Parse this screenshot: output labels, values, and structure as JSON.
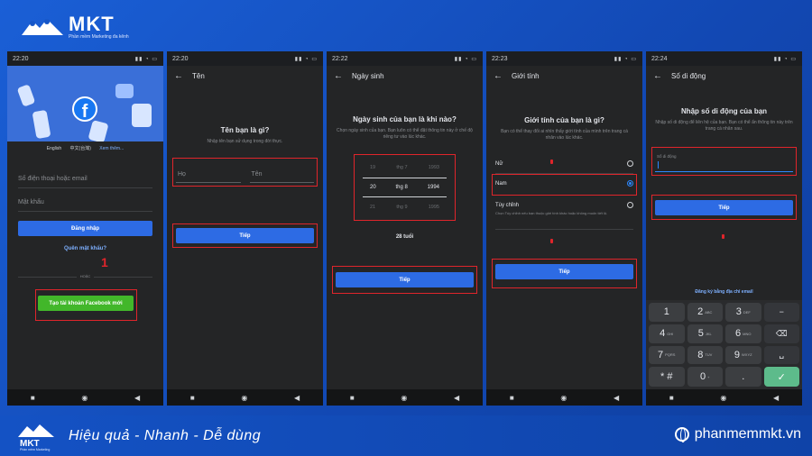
{
  "brand": {
    "name": "MKT",
    "tagline": "Phần mềm Marketing đa kênh"
  },
  "footer": {
    "slogan": "Hiệu quả - Nhanh  - Dễ dùng",
    "website": "phanmemmkt.vn",
    "brand": "MKT",
    "tagline": "Phần mềm Marketing"
  },
  "screens": {
    "login": {
      "time": "22:20",
      "languages": [
        "English",
        "中文(台灣)",
        "Xem thêm..."
      ],
      "phone_placeholder": "Số điện thoại hoặc email",
      "password_placeholder": "Mật khẩu",
      "login_button": "Đăng nhập",
      "forgot_link": "Quên mật khẩu?",
      "or_label": "HOẶC",
      "create_button": "Tạo tài khoản Facebook mới",
      "step_marker": "1"
    },
    "name": {
      "time": "22:20",
      "appbar_title": "Tên",
      "title": "Tên bạn là gì?",
      "subtitle": "Nhập tên bạn sử dụng trong đời thực.",
      "last_name": "Họ",
      "first_name": "Tên",
      "next_button": "Tiếp"
    },
    "birthday": {
      "time": "22:22",
      "appbar_title": "Ngày sinh",
      "title": "Ngày sinh của bạn là khi nào?",
      "subtitle": "Chọn ngày sinh của bạn. Bạn luôn có thể đặt thông tin này ở chế độ riêng tư vào lúc khác.",
      "picker": [
        {
          "day": "19",
          "month": "thg 7",
          "year": "1993"
        },
        {
          "day": "20",
          "month": "thg 8",
          "year": "1994"
        },
        {
          "day": "21",
          "month": "thg 9",
          "year": "1995"
        }
      ],
      "age": "28 tuổi",
      "next_button": "Tiếp"
    },
    "gender": {
      "time": "22:23",
      "appbar_title": "Giới tính",
      "title": "Giới tính của bạn là gì?",
      "subtitle": "Bạn có thể thay đổi ai nhìn thấy giới tính của mình trên trang cá nhân vào lúc khác.",
      "female": "Nữ",
      "male": "Nam",
      "custom": "Tùy chỉnh",
      "custom_desc": "Chọn Tùy chỉnh nếu bạn thuộc giới tính khác hoặc không muốn tiết lộ.",
      "next_button": "Tiếp"
    },
    "mobile": {
      "time": "22:24",
      "appbar_title": "Số di động",
      "title": "Nhập số di động của bạn",
      "subtitle": "Nhập số di động để liên hệ của bạn. Bạn có thể ẩn thông tin này trên trang cá nhân sau.",
      "field_label": "Số di động",
      "next_button": "Tiếp",
      "email_link": "Đăng ký bằng địa chỉ email",
      "keys": [
        {
          "main": "1",
          "sub": ""
        },
        {
          "main": "2",
          "sub": "ABC"
        },
        {
          "main": "3",
          "sub": "DEF"
        },
        {
          "main": "−",
          "sub": ""
        },
        {
          "main": "4",
          "sub": "GHI"
        },
        {
          "main": "5",
          "sub": "JKL"
        },
        {
          "main": "6",
          "sub": "MNO"
        },
        {
          "main": "⌫",
          "sub": ""
        },
        {
          "main": "7",
          "sub": "PQRS"
        },
        {
          "main": "8",
          "sub": "TUV"
        },
        {
          "main": "9",
          "sub": "WXYZ"
        },
        {
          "main": "␣",
          "sub": ""
        },
        {
          "main": "* #",
          "sub": ""
        },
        {
          "main": "0",
          "sub": "+"
        },
        {
          "main": ".",
          "sub": ""
        },
        {
          "main": "✓",
          "sub": ""
        }
      ]
    }
  },
  "nav_icons": [
    "square-icon",
    "circle-icon",
    "back-triangle-icon"
  ],
  "colors": {
    "highlight": "#e0252b",
    "fb_blue": "#2d6be4",
    "green": "#42b72a",
    "dark_bg": "#242526"
  }
}
